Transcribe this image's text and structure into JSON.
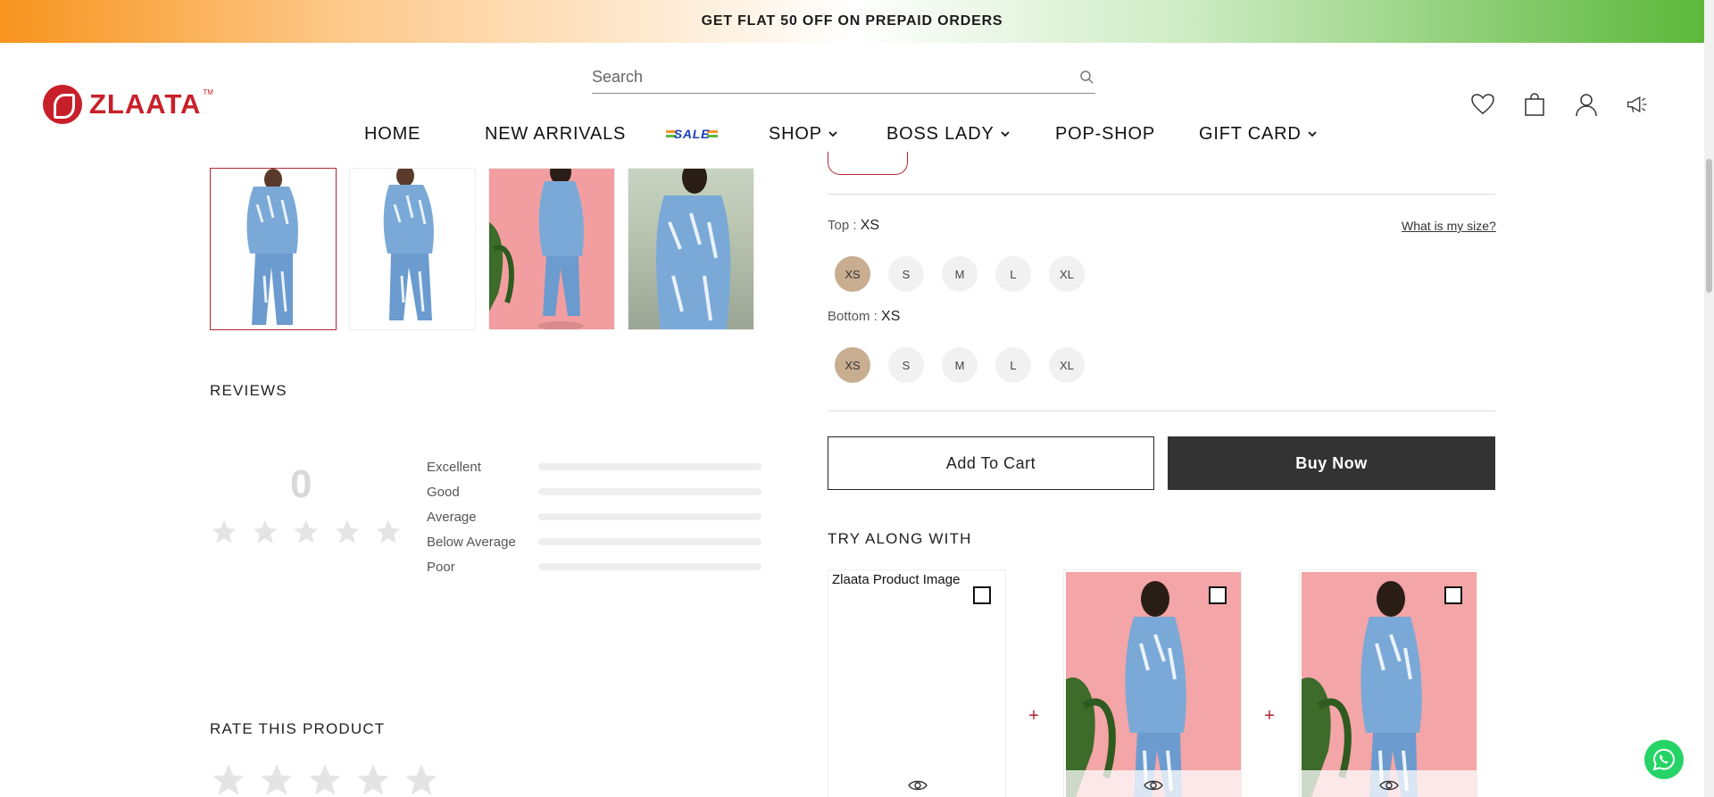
{
  "promo": {
    "text": "GET FLAT 50 OFF ON PREPAID ORDERS"
  },
  "brand": {
    "name": "ZLAATA",
    "tm": "TM"
  },
  "search": {
    "placeholder": "Search"
  },
  "nav": {
    "home": "HOME",
    "new_arrivals": "NEW ARRIVALS",
    "sale": "SALE",
    "shop": "SHOP",
    "boss_lady": "BOSS LADY",
    "pop_shop": "POP-SHOP",
    "gift_card": "GIFT CARD"
  },
  "reviews": {
    "title": "REVIEWS",
    "average": "0",
    "rating_value": 0,
    "breakdown": [
      "Excellent",
      "Good",
      "Average",
      "Below Average",
      "Poor"
    ]
  },
  "rate": {
    "title": "RATE THIS PRODUCT"
  },
  "sizes": {
    "top_label": "Top : ",
    "top_value": "XS",
    "bottom_label": "Bottom : ",
    "bottom_value": "XS",
    "help": "What is my size?",
    "options": [
      "XS",
      "S",
      "M",
      "L",
      "XL"
    ]
  },
  "actions": {
    "add_to_cart": "Add To Cart",
    "buy_now": "Buy Now"
  },
  "try_along": {
    "title": "TRY ALONG WITH",
    "broken_alt": "Zlaata Product Image"
  },
  "colors": {
    "accent": "#b4242f",
    "dark_button": "#333333",
    "selected_size": "#c9ad90",
    "whatsapp": "#25d366"
  }
}
